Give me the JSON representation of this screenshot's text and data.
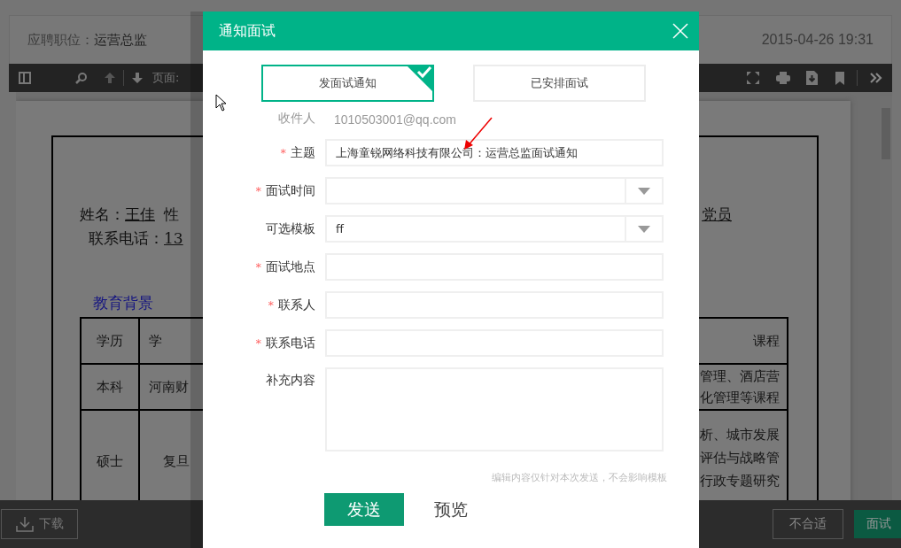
{
  "header": {
    "position_label": "应聘职位：",
    "position": "运营总监",
    "datetime": "2015-04-26 19:31"
  },
  "toolbar": {
    "page_label": "页面:"
  },
  "resume": {
    "name_label": "姓名：",
    "name": "王佳",
    "gender_label": "性",
    "party": "党员",
    "phone_label": "联系电话：",
    "phone": "13",
    "section_title": "教育背景",
    "table": {
      "columns": [
        "学历",
        "学",
        "课程"
      ],
      "rows": [
        {
          "degree": "本科",
          "school": "河南财",
          "courses": [
            "管理、酒店营",
            "化管理等课程"
          ]
        },
        {
          "degree": "硕士",
          "school": "复旦",
          "courses": [
            "析、城市发展",
            "评估与战略管",
            "行政专题研究"
          ]
        }
      ]
    }
  },
  "bottom_bar": {
    "download": "下载",
    "reject": "不合适",
    "interview": "面试"
  },
  "dialog": {
    "title": "通知面试",
    "tabs": [
      {
        "label": "发面试通知",
        "selected": true
      },
      {
        "label": "已安排面试",
        "selected": false
      }
    ],
    "recipient": {
      "label": "收件人",
      "value": "1010503001@qq.com"
    },
    "fields": [
      {
        "required_mark": "*",
        "label": "主题",
        "kind": "text",
        "value": "上海童锐网络科技有限公司：运营总监面试通知"
      },
      {
        "required_mark": "*",
        "label": "面试时间",
        "kind": "select"
      },
      {
        "label": "可选模板",
        "kind": "select",
        "value": "ff"
      },
      {
        "required_mark": "*",
        "label": "面试地点",
        "kind": "text"
      },
      {
        "required_mark": "*",
        "label": "联系人",
        "kind": "text"
      },
      {
        "required_mark": "*",
        "label": "联系电话",
        "kind": "text"
      },
      {
        "label": "补充内容",
        "kind": "textarea"
      }
    ],
    "hint": "编辑内容仅针对本次发送，不会影响模板",
    "send_button": "发送",
    "preview_link": "预览"
  }
}
